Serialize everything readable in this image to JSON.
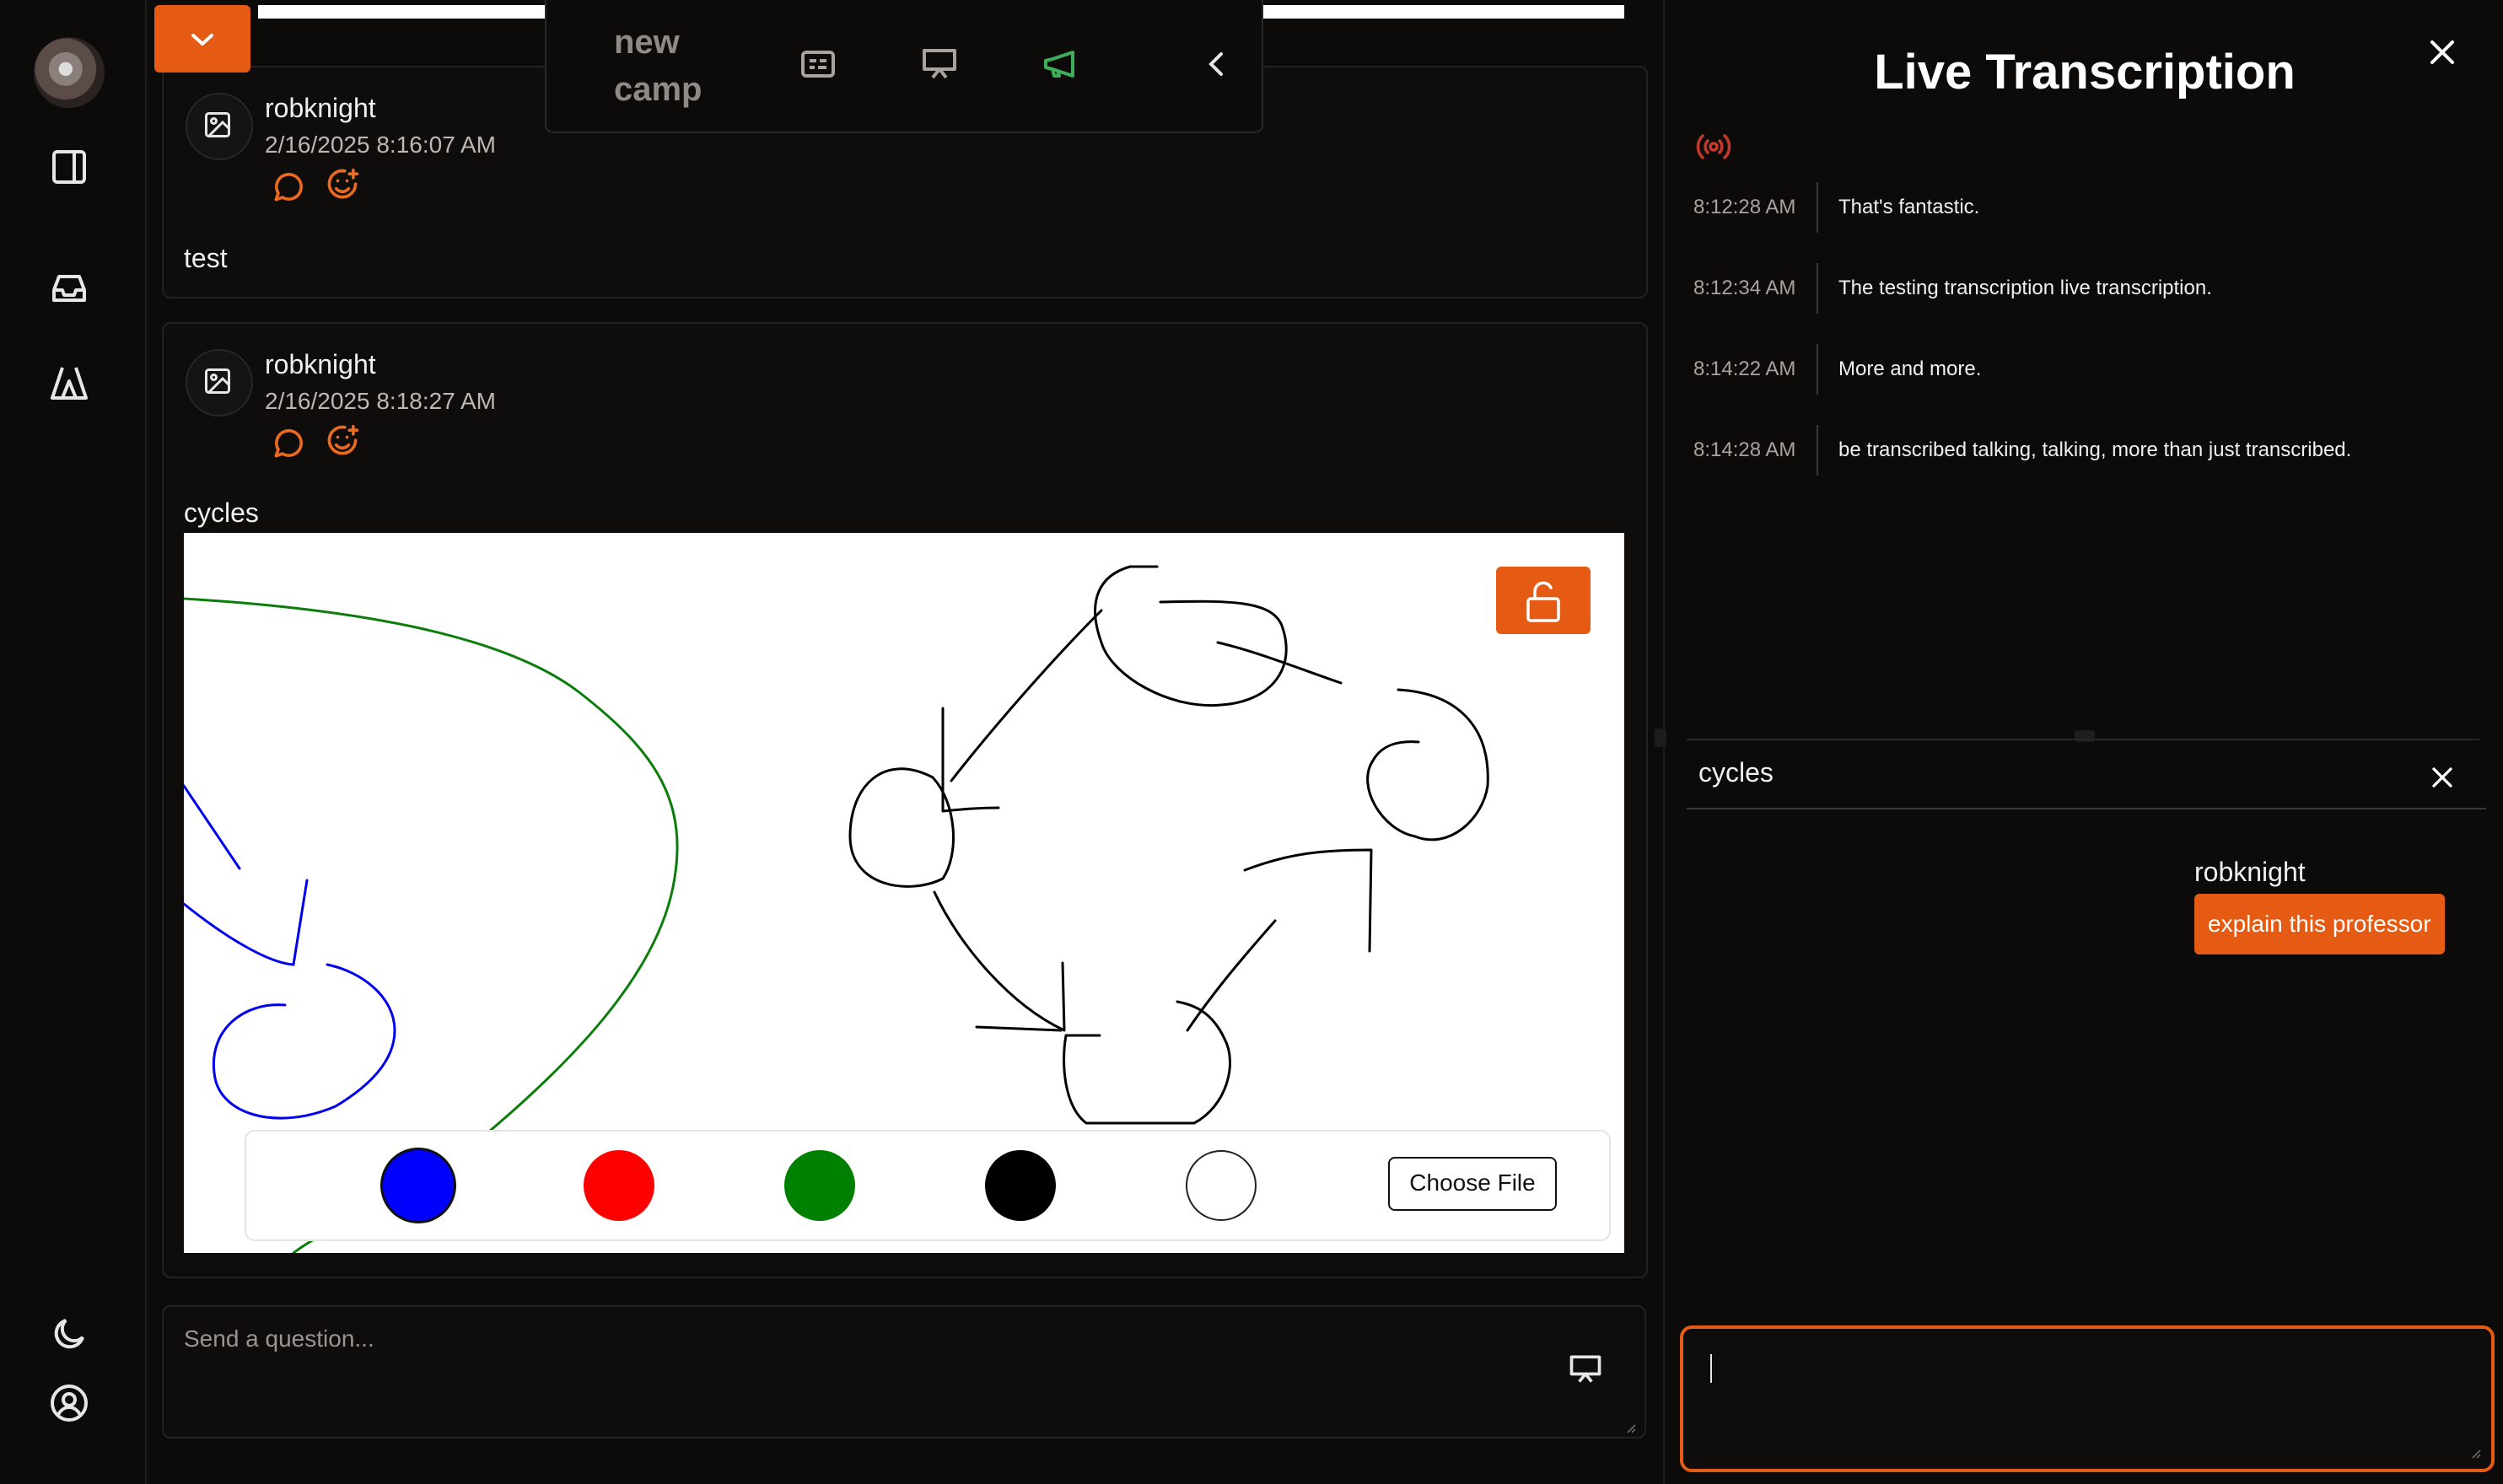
{
  "header": {
    "camp_name": "new\ncamp"
  },
  "posts": [
    {
      "author": "robknight",
      "timestamp": "2/16/2025 8:16:07 AM",
      "body": "test"
    },
    {
      "author": "robknight",
      "timestamp": "2/16/2025 8:18:27 AM",
      "body": "cycles"
    }
  ],
  "whiteboard": {
    "palette": [
      {
        "name": "blue",
        "color": "#0000ff"
      },
      {
        "name": "red",
        "color": "#ff0000"
      },
      {
        "name": "green",
        "color": "#008000"
      },
      {
        "name": "black",
        "color": "#000000"
      },
      {
        "name": "white",
        "color": "#ffffff"
      }
    ],
    "choose_file_label": "Choose File"
  },
  "question": {
    "placeholder": "Send a question..."
  },
  "transcription": {
    "title": "Live Transcription",
    "entries": [
      {
        "time": "8:12:28 AM",
        "text": "That's fantastic."
      },
      {
        "time": "8:12:34 AM",
        "text": "The testing transcription live transcription."
      },
      {
        "time": "8:14:22 AM",
        "text": "More and more."
      },
      {
        "time": "8:14:28 AM",
        "text": "be transcribed talking, talking, more than just transcribed."
      }
    ]
  },
  "chat": {
    "title": "cycles",
    "messages": [
      {
        "author": "robknight",
        "text": "explain this professor"
      }
    ],
    "input_value": ""
  },
  "colors": {
    "accent": "#e55b13",
    "live_indicator": "#c0392b",
    "megaphone": "#3fae5a"
  }
}
